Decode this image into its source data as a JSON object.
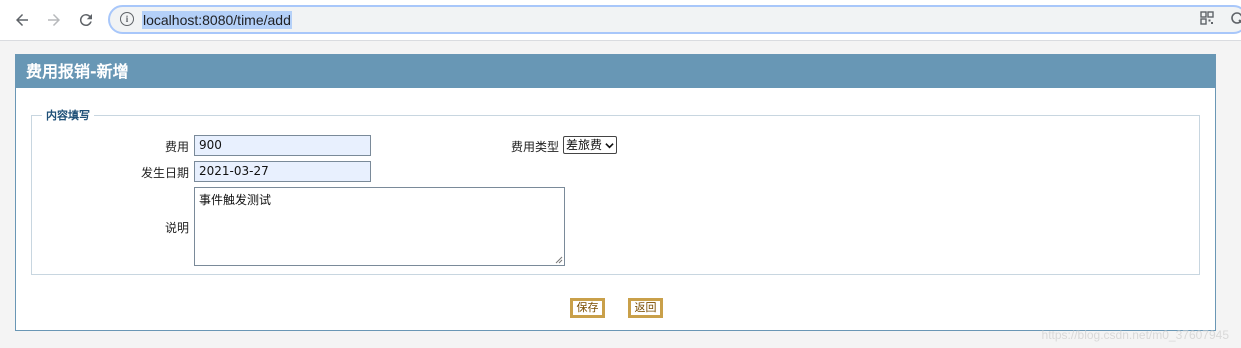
{
  "browser": {
    "url": "localhost:8080/time/add"
  },
  "page": {
    "title": "费用报销-新增",
    "fieldset_legend": "内容填写",
    "fields": {
      "amount_label": "费用",
      "amount_value": "900",
      "type_label": "费用类型",
      "type_selected": "差旅费",
      "date_label": "发生日期",
      "date_value": "2021-03-27",
      "desc_label": "说明",
      "desc_value": "事件触发测试"
    },
    "buttons": {
      "save": "保存",
      "back": "返回"
    },
    "watermark": "https://blog.csdn.net/m0_37607945"
  }
}
